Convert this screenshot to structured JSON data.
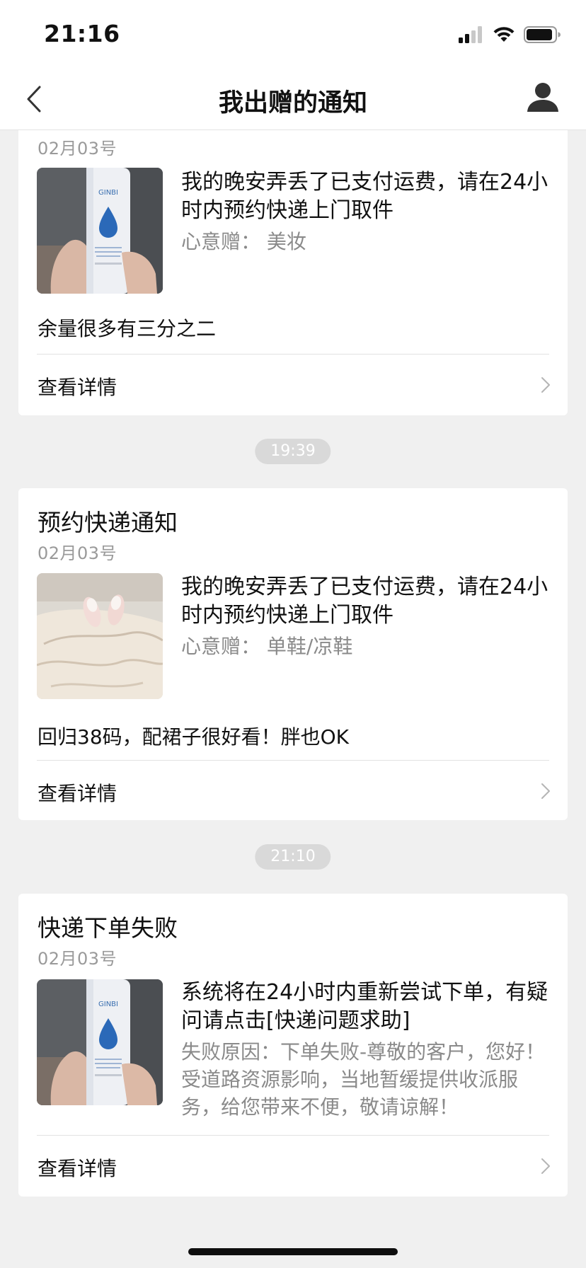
{
  "status_bar": {
    "time": "21:16"
  },
  "nav": {
    "title": "我出赠的通知"
  },
  "cards": [
    {
      "date": "02月03号",
      "main_text": "我的晚安弄丢了已支付运费，请在24小时内预约快递上门取件",
      "sub_text": "心意赠：  美妆",
      "note": "余量很多有三分之二",
      "detail_label": "查看详情"
    },
    {
      "title": "预约快递通知",
      "date": "02月03号",
      "main_text": "我的晚安弄丢了已支付运费，请在24小时内预约快递上门取件",
      "sub_text": "心意赠：  单鞋/凉鞋",
      "note": "回归38码，配裙子很好看！胖也OK",
      "detail_label": "查看详情"
    },
    {
      "title": "快递下单失败",
      "date": "02月03号",
      "main_text": "系统将在24小时内重新尝试下单，有疑问请点击[快递问题求助]",
      "sub_text": "失败原因：下单失败-尊敬的客户，您好！受道路资源影响，当地暂缓提供收派服务，给您带来不便，敬请谅解！",
      "detail_label": "查看详情"
    }
  ],
  "time_separators": [
    "19:39",
    "21:10"
  ],
  "thumb_labels": {
    "bottle_brand": "GINBI"
  },
  "icons": {
    "back": "chevron-left-icon",
    "profile": "user-profile-icon",
    "detail": "chevron-right-icon",
    "signal": "signal-icon",
    "wifi": "wifi-icon",
    "battery": "battery-icon"
  }
}
